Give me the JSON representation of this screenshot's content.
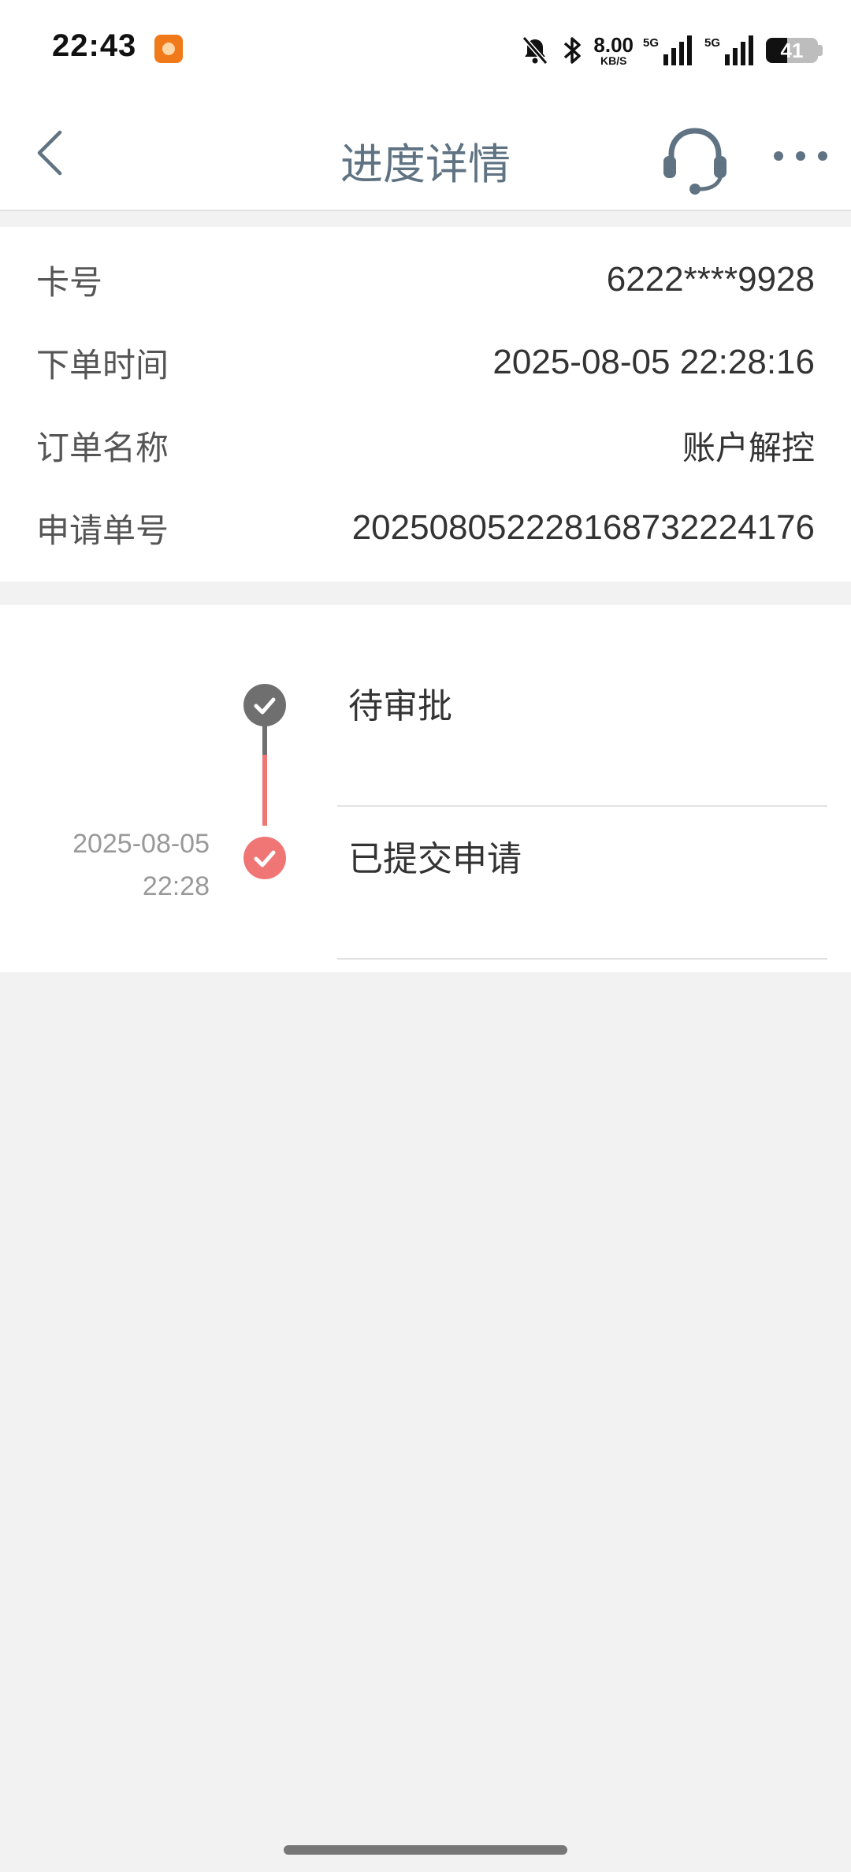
{
  "status_bar": {
    "time": "22:43",
    "net_speed_value": "8.00",
    "net_speed_unit": "KB/S",
    "network_1": "5G",
    "network_2": "5G",
    "battery_level": "41",
    "battery_fraction": 0.41,
    "icons": [
      "app-notification-icon",
      "mute-bell-icon",
      "bluetooth-icon",
      "signal-icon",
      "battery-icon"
    ]
  },
  "header": {
    "title": "进度详情",
    "back_icon": "chevron-left-icon",
    "service_icon": "headset-icon",
    "more_icon": "more-horizontal-icon"
  },
  "info": {
    "rows": [
      {
        "label": "卡号",
        "value": "6222****9928"
      },
      {
        "label": "下单时间",
        "value": "2025-08-05 22:28:16"
      },
      {
        "label": "订单名称",
        "value": "账户解控"
      },
      {
        "label": "申请单号",
        "value": "20250805222816873222417­6"
      }
    ]
  },
  "timeline": {
    "steps": [
      {
        "title": "待审批",
        "date": "",
        "time": "",
        "status": "pending"
      },
      {
        "title": "已提交申请",
        "date": "2025-08-05",
        "time": "22:28",
        "status": "done"
      }
    ]
  },
  "colors": {
    "title": "#5f7383",
    "pending_dot": "#6f6f6f",
    "done_dot": "#f07676",
    "page_bg": "#f2f2f2"
  }
}
